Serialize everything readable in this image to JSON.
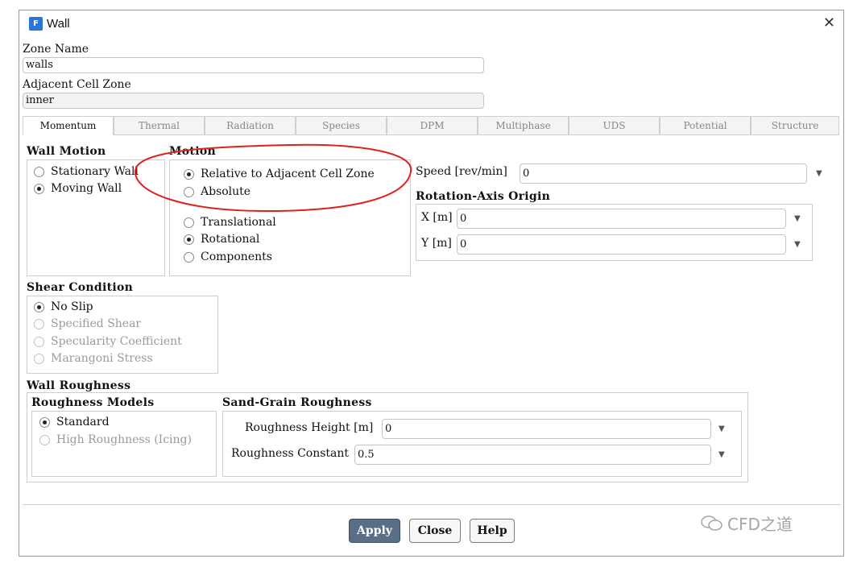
{
  "window": {
    "title": "Wall",
    "app_icon_letter": "F",
    "close_glyph": "✕"
  },
  "zone_name": {
    "label": "Zone Name",
    "value": "walls"
  },
  "adjacent_cell_zone": {
    "label": "Adjacent Cell Zone",
    "value": "inner"
  },
  "tabs": [
    {
      "label": "Momentum",
      "active": true
    },
    {
      "label": "Thermal"
    },
    {
      "label": "Radiation"
    },
    {
      "label": "Species"
    },
    {
      "label": "DPM"
    },
    {
      "label": "Multiphase"
    },
    {
      "label": "UDS"
    },
    {
      "label": "Potential"
    },
    {
      "label": "Structure"
    }
  ],
  "wall_motion": {
    "header": "Wall Motion",
    "options": [
      {
        "label": "Stationary Wall",
        "selected": false
      },
      {
        "label": "Moving Wall",
        "selected": true
      }
    ]
  },
  "motion": {
    "header": "Motion",
    "reference_options": [
      {
        "label": "Relative to Adjacent Cell Zone",
        "selected": true
      },
      {
        "label": "Absolute",
        "selected": false
      }
    ],
    "type_options": [
      {
        "label": "Translational",
        "selected": false
      },
      {
        "label": "Rotational",
        "selected": true
      },
      {
        "label": "Components",
        "selected": false
      }
    ]
  },
  "speed": {
    "label": "Speed [rev/min]",
    "value": "0"
  },
  "rotation_axis_origin": {
    "header": "Rotation-Axis Origin",
    "x_label": "X [m]",
    "x_value": "0",
    "y_label": "Y [m]",
    "y_value": "0"
  },
  "shear_condition": {
    "header": "Shear Condition",
    "options": [
      {
        "label": "No Slip",
        "selected": true,
        "enabled": true
      },
      {
        "label": "Specified Shear",
        "enabled": false
      },
      {
        "label": "Specularity Coefficient",
        "enabled": false
      },
      {
        "label": "Marangoni Stress",
        "enabled": false
      }
    ]
  },
  "wall_roughness": {
    "header": "Wall Roughness",
    "models_header": "Roughness Models",
    "models": [
      {
        "label": "Standard",
        "selected": true,
        "enabled": true
      },
      {
        "label": "High Roughness (Icing)",
        "enabled": false
      }
    ],
    "sand_grain_header": "Sand-Grain Roughness",
    "height_label": "Roughness Height [m]",
    "height_value": "0",
    "constant_label": "Roughness Constant",
    "constant_value": "0.5"
  },
  "buttons": {
    "apply": "Apply",
    "close": "Close",
    "help": "Help"
  },
  "watermark": {
    "text": "CFD之道"
  },
  "colors": {
    "annotation_circle": "#e0201e",
    "apply_button": "#5a6f86",
    "app_icon": "#2b74d9"
  }
}
